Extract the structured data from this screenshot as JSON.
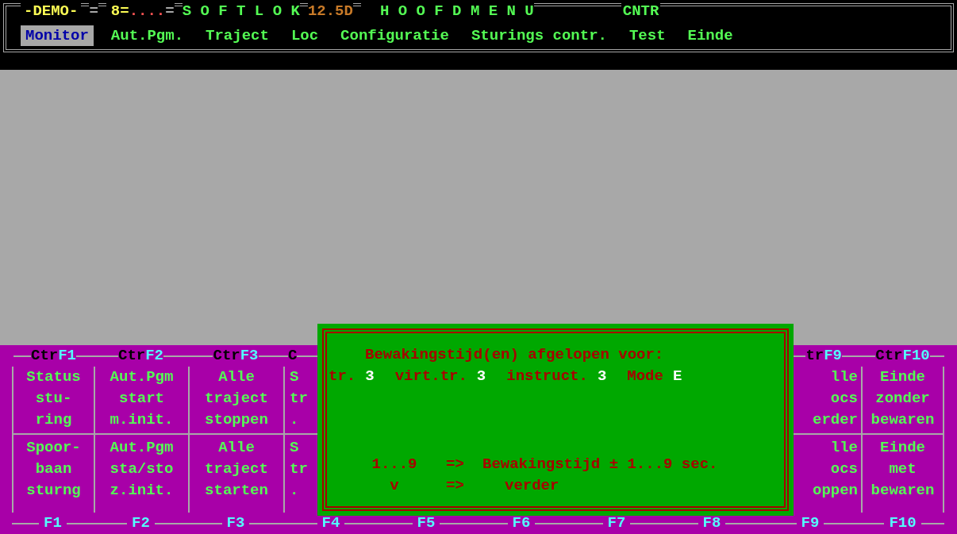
{
  "header": {
    "demo": "-DEMO-",
    "sep1": "=",
    "counter": "8=",
    "dots": "....",
    "sep2": "=",
    "product": "S O F T L O K",
    "version": "12.5D",
    "title": "H O O F D M E N U",
    "mode": "CNTR"
  },
  "menu": [
    {
      "label": "Monitor",
      "selected": true
    },
    {
      "label": "Aut.Pgm.",
      "selected": false
    },
    {
      "label": "Traject",
      "selected": false
    },
    {
      "label": "Loc",
      "selected": false
    },
    {
      "label": "Configuratie",
      "selected": false
    },
    {
      "label": "Sturings contr.",
      "selected": false
    },
    {
      "label": "Test",
      "selected": false
    },
    {
      "label": "Einde",
      "selected": false
    }
  ],
  "function_keys": [
    {
      "kind": "whole",
      "ctrl_prefix": "Ctr",
      "ctrl_key": "F1",
      "top": [
        "Status",
        "stu-",
        "ring"
      ],
      "bottom": [
        "Spoor-",
        "baan",
        "sturng"
      ],
      "key": "F1"
    },
    {
      "kind": "whole",
      "ctrl_prefix": "Ctr",
      "ctrl_key": "F2",
      "top": [
        "Aut.Pgm",
        "start",
        "m.init."
      ],
      "bottom": [
        "Aut.Pgm",
        "sta/sto",
        "z.init."
      ],
      "key": "F2"
    },
    {
      "kind": "whole",
      "ctrl_prefix": "Ctr",
      "ctrl_key": "F3",
      "top": [
        "Alle",
        "traject",
        "stoppen"
      ],
      "bottom": [
        "Alle",
        "traject",
        "starten"
      ],
      "key": "F3"
    },
    {
      "kind": "left_part",
      "ctrl_prefix": "C",
      "top": [
        "S",
        "tr",
        "."
      ],
      "bottom": [
        "S",
        "tr",
        "."
      ],
      "key": "F4"
    },
    {
      "kind": "whole",
      "key": "F5"
    },
    {
      "kind": "whole",
      "key": "F6"
    },
    {
      "kind": "whole",
      "key": "F7"
    },
    {
      "kind": "whole",
      "key": "F8"
    },
    {
      "kind": "right_part",
      "ctrl_prefix": "tr",
      "ctrl_key": "F9",
      "top": [
        "lle",
        "ocs",
        "erder"
      ],
      "bottom": [
        "lle",
        "ocs",
        "oppen"
      ],
      "key": "F9"
    },
    {
      "kind": "whole",
      "ctrl_prefix": "Ctr",
      "ctrl_key": "F10",
      "top": [
        "Einde",
        "zonder",
        "bewaren"
      ],
      "bottom": [
        "Einde",
        "met",
        "bewaren"
      ],
      "key": "F10"
    }
  ],
  "dialog": {
    "title": "Bewakingstijd(en) afgelopen voor:",
    "details": [
      {
        "kind": "label",
        "text": "tr."
      },
      {
        "kind": "value",
        "text": "3"
      },
      {
        "kind": "label",
        "text": "virt.tr."
      },
      {
        "kind": "value",
        "text": "3"
      },
      {
        "kind": "label",
        "text": "instruct."
      },
      {
        "kind": "value",
        "text": "3"
      },
      {
        "kind": "label",
        "text": "Mode"
      },
      {
        "kind": "value",
        "text": "E"
      }
    ],
    "options": [
      {
        "key": "1...9",
        "arrow": "=>",
        "action": "Bewakingstijd ± 1...9 sec."
      },
      {
        "key": "v",
        "arrow": "=>",
        "action": "verder"
      }
    ]
  }
}
